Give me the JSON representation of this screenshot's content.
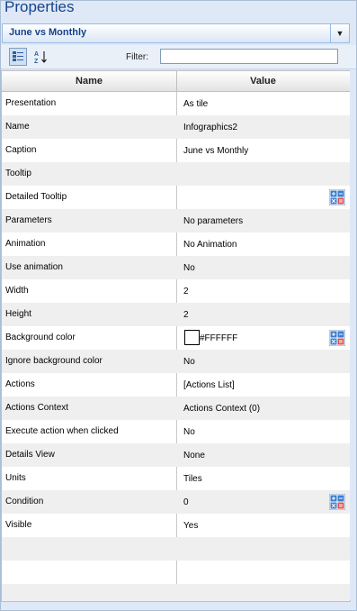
{
  "panel": {
    "title": "Properties",
    "dropdown": {
      "selected": "June vs Monthly"
    }
  },
  "toolbar": {
    "filter_label": "Filter:",
    "filter_value": "",
    "buttons": [
      "categorized-icon",
      "sort-az-icon"
    ]
  },
  "grid": {
    "headers": {
      "name": "Name",
      "value": "Value"
    },
    "rows": [
      {
        "name": "Presentation",
        "value": "As tile"
      },
      {
        "name": "Name",
        "value": "Infographics2"
      },
      {
        "name": "Caption",
        "value": "June vs Monthly"
      },
      {
        "name": "Tooltip",
        "value": ""
      },
      {
        "name": "Detailed Tooltip",
        "value": ""
      },
      {
        "name": "Parameters",
        "value": "No parameters"
      },
      {
        "name": "Animation",
        "value": "No Animation"
      },
      {
        "name": "Use animation",
        "value": "No"
      },
      {
        "name": "Width",
        "value": "2"
      },
      {
        "name": "Height",
        "value": "2"
      },
      {
        "name": "Background color",
        "value": "#FFFFFF"
      },
      {
        "name": "Ignore background color",
        "value": "No"
      },
      {
        "name": "Actions",
        "value": "[Actions List]"
      },
      {
        "name": "Actions Context",
        "value": "Actions Context (0)"
      },
      {
        "name": "Execute action when clicked",
        "value": "No"
      },
      {
        "name": "Details View",
        "value": "None"
      },
      {
        "name": "Units",
        "value": "Tiles"
      },
      {
        "name": "Condition",
        "value": "0"
      },
      {
        "name": "Visible",
        "value": "Yes"
      }
    ]
  },
  "colors": {
    "accent": "#15428b",
    "panel_bg": "#dfe8f6",
    "swatch": "#FFFFFF"
  }
}
